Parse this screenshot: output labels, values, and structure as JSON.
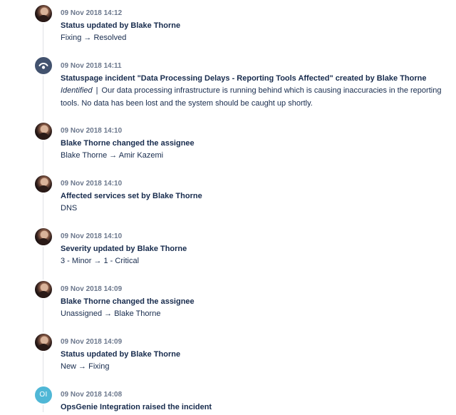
{
  "timeline": {
    "entries": [
      {
        "avatar": "user-photo",
        "timestamp": "09 Nov 2018 14:12",
        "title": "Status updated by Blake Thorne",
        "detail": "Fixing → Resolved"
      },
      {
        "avatar": "statuspage-icon",
        "timestamp": "09 Nov 2018 14:11",
        "title": "Statuspage incident \"Data Processing Delays - Reporting Tools Affected\" created by Blake Thorne",
        "status_label": "Identified",
        "separator": "|",
        "description": "Our data processing infrastructure is running behind which is causing inaccuracies in the reporting tools. No data has been lost and the system should be caught up shortly."
      },
      {
        "avatar": "user-photo",
        "timestamp": "09 Nov 2018 14:10",
        "title": "Blake Thorne changed the assignee",
        "detail": "Blake Thorne → Amir Kazemi"
      },
      {
        "avatar": "user-photo",
        "timestamp": "09 Nov 2018 14:10",
        "title": "Affected services set by Blake Thorne",
        "detail": "DNS"
      },
      {
        "avatar": "user-photo",
        "timestamp": "09 Nov 2018 14:10",
        "title": "Severity updated by Blake Thorne",
        "detail": "3 - Minor → 1 - Critical"
      },
      {
        "avatar": "user-photo",
        "timestamp": "09 Nov 2018 14:09",
        "title": "Blake Thorne changed the assignee",
        "detail": "Unassigned → Blake Thorne"
      },
      {
        "avatar": "user-photo",
        "timestamp": "09 Nov 2018 14:09",
        "title": "Status updated by Blake Thorne",
        "detail": "New → Fixing"
      },
      {
        "avatar": "initials",
        "initials": "OI",
        "timestamp": "09 Nov 2018 14:08",
        "title": "OpsGenie Integration raised the incident"
      }
    ]
  },
  "colors": {
    "text": "#172b4d",
    "muted": "#6b778c",
    "line": "#dfe1e6",
    "statuspage_badge": "#42526e",
    "opsgenie_badge": "#4fb7d6"
  }
}
